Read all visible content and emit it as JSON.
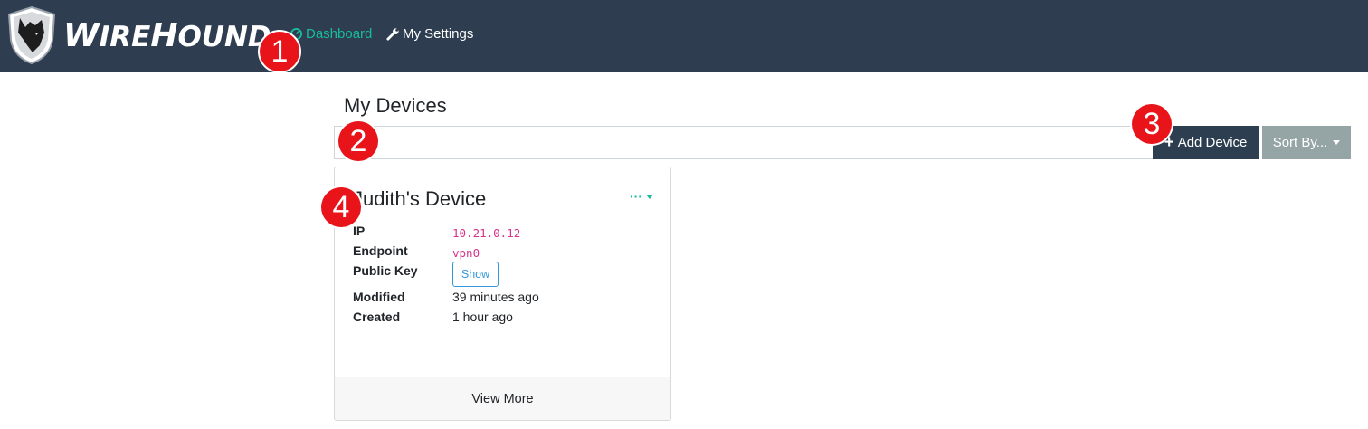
{
  "app": {
    "brand": "WireHound",
    "brand_w": "W",
    "brand_ire": "IRE",
    "brand_h": "H",
    "brand_ound": "OUND"
  },
  "nav": {
    "dashboard": "Dashboard",
    "settings": "My Settings"
  },
  "markers": [
    "1",
    "2",
    "3",
    "4"
  ],
  "page": {
    "title": "My Devices"
  },
  "search": {
    "value": "",
    "placeholder": ""
  },
  "toolbar": {
    "add_label": "Add Device",
    "add_icon": "plus-icon",
    "sort_label": "Sort By..."
  },
  "device": {
    "name": "Judith's Device",
    "menu": "···",
    "fields": {
      "ip_label": "IP",
      "ip_value": "10.21.0.12",
      "endpoint_label": "Endpoint",
      "endpoint_value": "vpn0",
      "pubkey_label": "Public Key",
      "pubkey_button": "Show",
      "modified_label": "Modified",
      "modified_value": "39 minutes ago",
      "created_label": "Created",
      "created_value": "1 hour ago"
    },
    "footer": "View More"
  },
  "colors": {
    "navbar": "#2e3e50",
    "accent": "#18bc9c",
    "primary_button": "#2c3e50",
    "secondary_button": "#95a5a6",
    "code": "#d6338a",
    "outline_button": "#3498db",
    "marker": "#e8141a"
  }
}
